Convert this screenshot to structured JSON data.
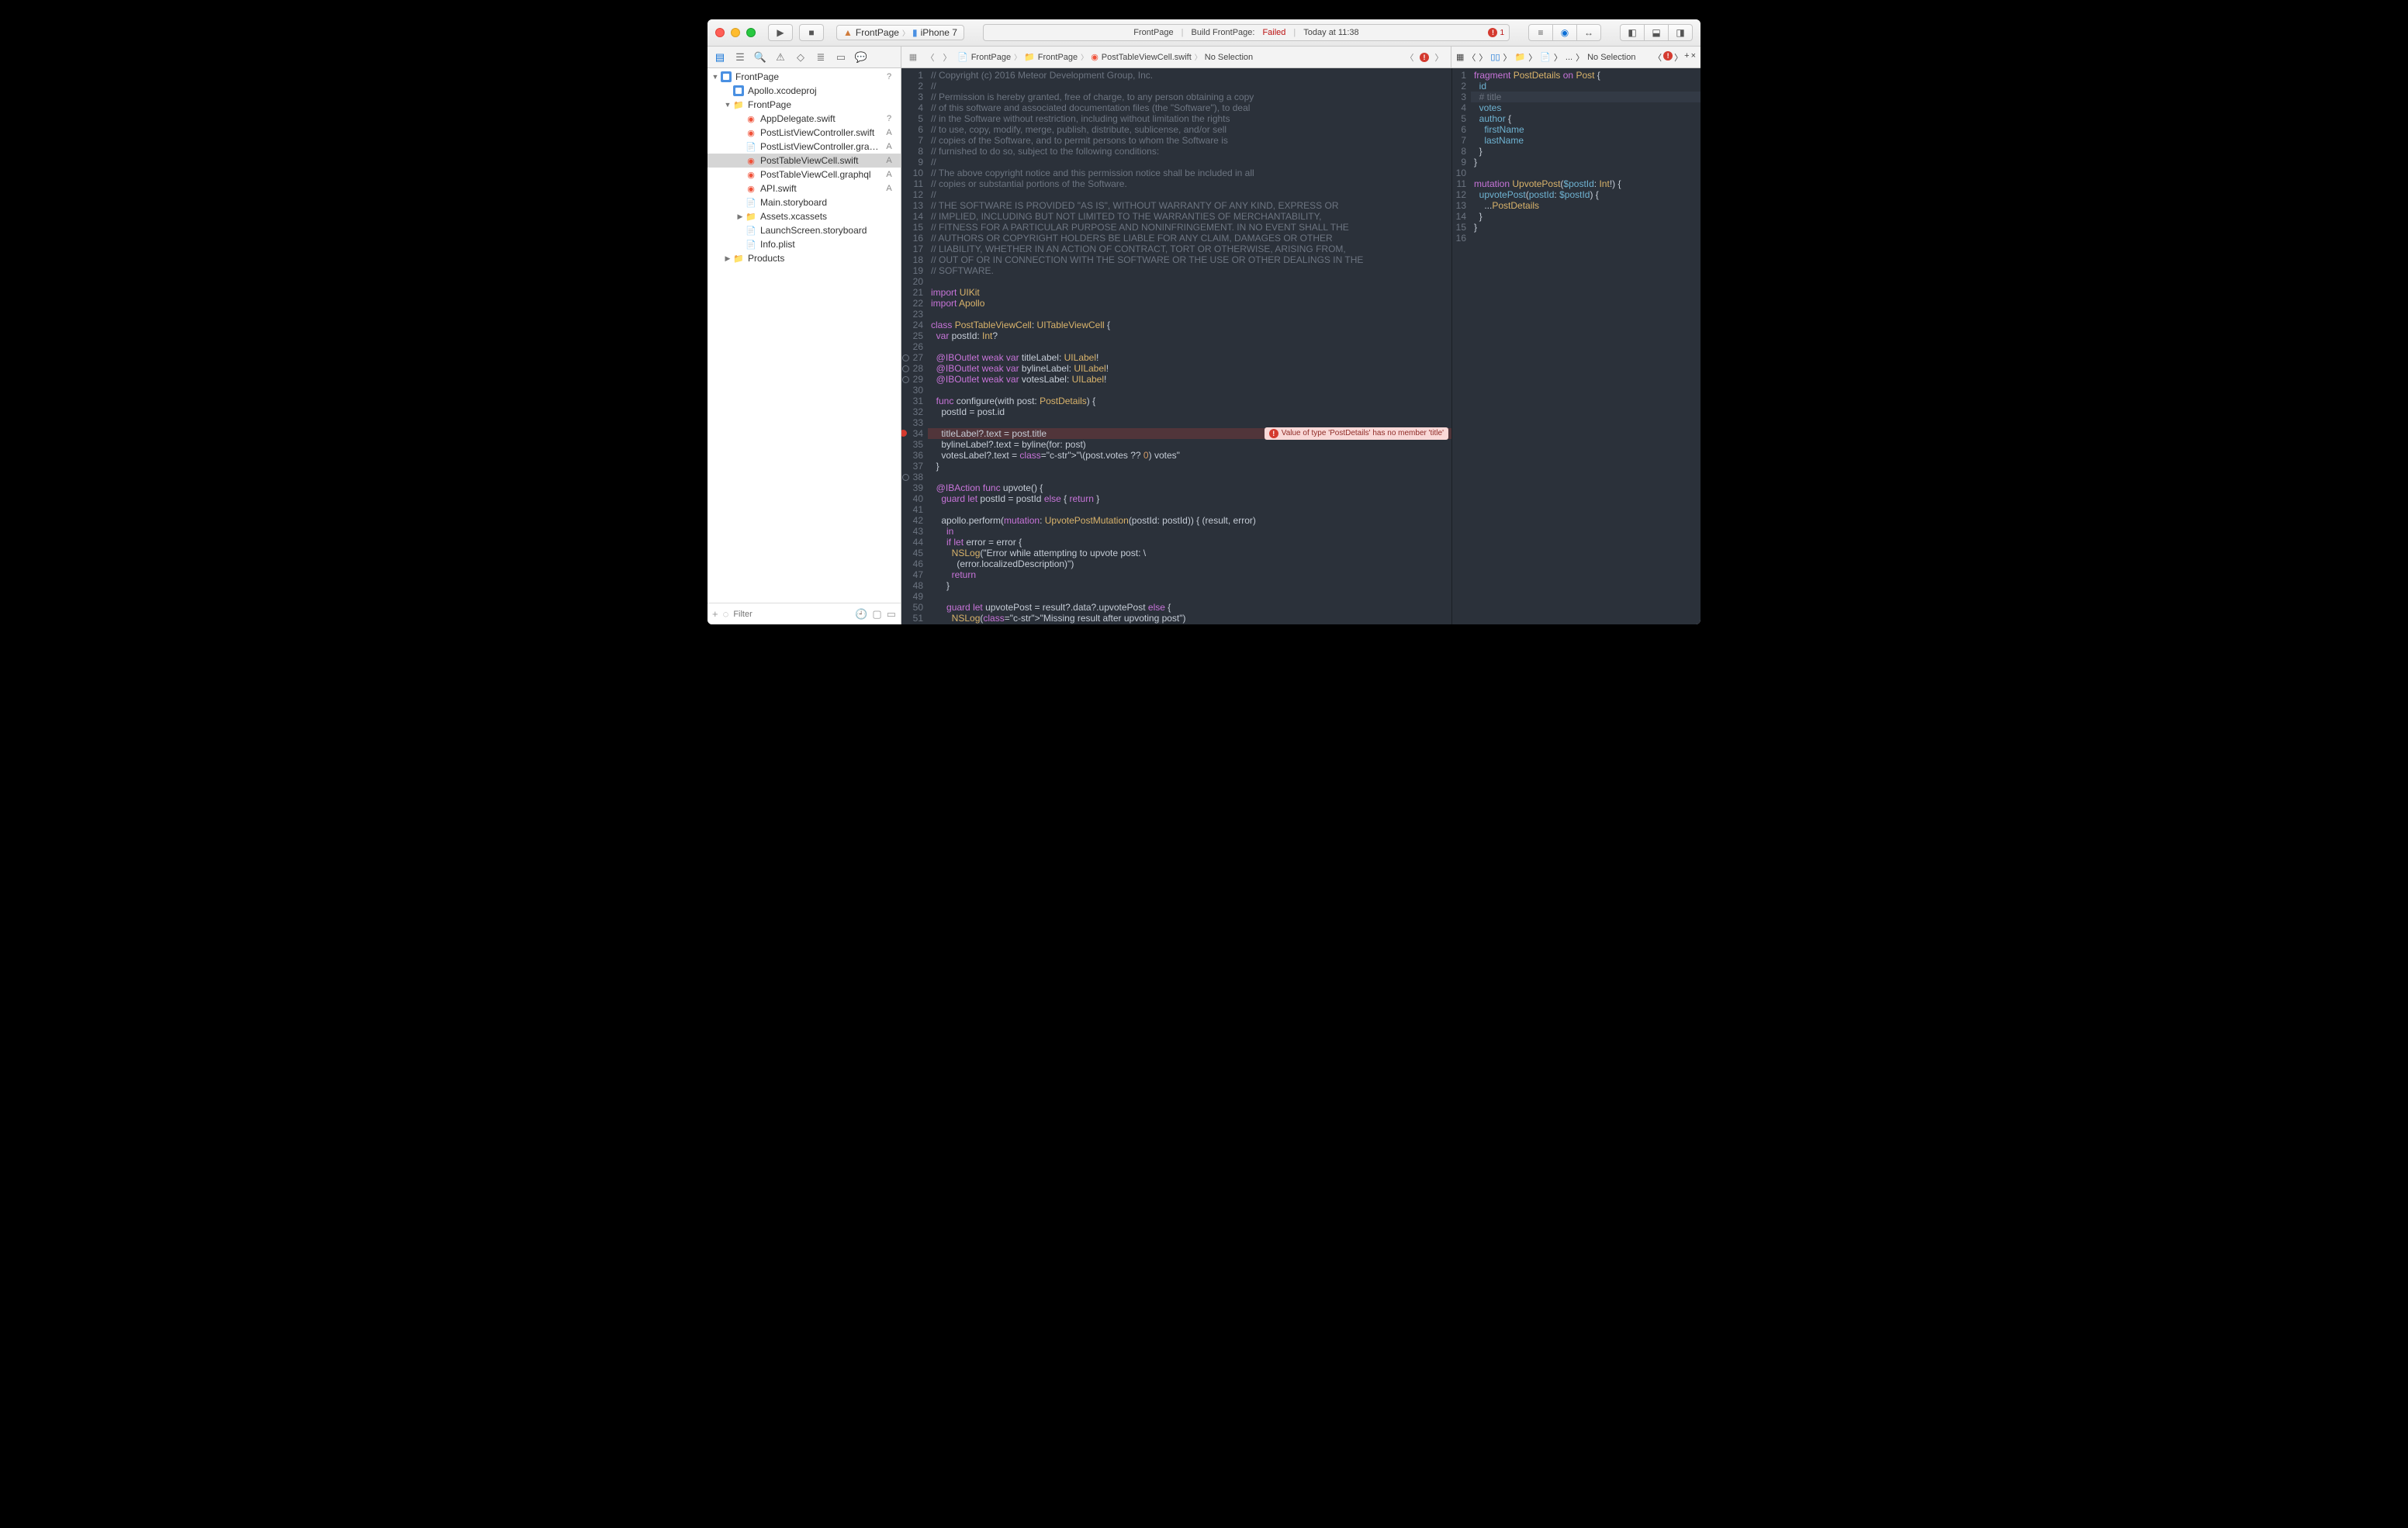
{
  "toolbar": {
    "scheme_target": "FrontPage",
    "scheme_device": "iPhone 7",
    "activity_project": "FrontPage",
    "activity_action": "Build FrontPage:",
    "activity_status": "Failed",
    "activity_time": "Today at 11:38",
    "error_count": "1"
  },
  "jumpbar1": {
    "items": [
      "FrontPage",
      "FrontPage",
      "PostTableViewCell.swift",
      "No Selection"
    ]
  },
  "jumpbar2": {
    "items": [
      "...",
      "No Selection"
    ]
  },
  "navigator": {
    "root": "FrontPage",
    "items": [
      {
        "label": "Apollo.xcodeproj",
        "indent": 1,
        "icon": "proj",
        "status": ""
      },
      {
        "label": "FrontPage",
        "indent": 1,
        "icon": "folder-y",
        "status": "",
        "open": true
      },
      {
        "label": "AppDelegate.swift",
        "indent": 2,
        "icon": "swift",
        "status": "?"
      },
      {
        "label": "PostListViewController.swift",
        "indent": 2,
        "icon": "swift",
        "status": "A"
      },
      {
        "label": "PostListViewController.graphql",
        "indent": 2,
        "icon": "file",
        "status": "A"
      },
      {
        "label": "PostTableViewCell.swift",
        "indent": 2,
        "icon": "swift",
        "status": "A",
        "selected": true
      },
      {
        "label": "PostTableViewCell.graphql",
        "indent": 2,
        "icon": "swift",
        "status": "A"
      },
      {
        "label": "API.swift",
        "indent": 2,
        "icon": "swift",
        "status": "A"
      },
      {
        "label": "Main.storyboard",
        "indent": 2,
        "icon": "sb",
        "status": ""
      },
      {
        "label": "Assets.xcassets",
        "indent": 2,
        "icon": "folder",
        "status": ""
      },
      {
        "label": "LaunchScreen.storyboard",
        "indent": 2,
        "icon": "sb",
        "status": ""
      },
      {
        "label": "Info.plist",
        "indent": 2,
        "icon": "plist",
        "status": ""
      },
      {
        "label": "Products",
        "indent": 1,
        "icon": "folder-y",
        "status": ""
      }
    ],
    "filter_placeholder": "Filter"
  },
  "editor1": {
    "error_line": 34,
    "error_msg": "Value of type 'PostDetails' has no member 'title'",
    "lines": [
      "// Copyright (c) 2016 Meteor Development Group, Inc.",
      "//",
      "// Permission is hereby granted, free of charge, to any person obtaining a copy",
      "// of this software and associated documentation files (the \"Software\"), to deal",
      "// in the Software without restriction, including without limitation the rights",
      "// to use, copy, modify, merge, publish, distribute, sublicense, and/or sell",
      "// copies of the Software, and to permit persons to whom the Software is",
      "// furnished to do so, subject to the following conditions:",
      "//",
      "// The above copyright notice and this permission notice shall be included in all",
      "// copies or substantial portions of the Software.",
      "//",
      "// THE SOFTWARE IS PROVIDED \"AS IS\", WITHOUT WARRANTY OF ANY KIND, EXPRESS OR",
      "// IMPLIED, INCLUDING BUT NOT LIMITED TO THE WARRANTIES OF MERCHANTABILITY,",
      "// FITNESS FOR A PARTICULAR PURPOSE AND NONINFRINGEMENT. IN NO EVENT SHALL THE",
      "// AUTHORS OR COPYRIGHT HOLDERS BE LIABLE FOR ANY CLAIM, DAMAGES OR OTHER",
      "// LIABILITY, WHETHER IN AN ACTION OF CONTRACT, TORT OR OTHERWISE, ARISING FROM,",
      "// OUT OF OR IN CONNECTION WITH THE SOFTWARE OR THE USE OR OTHER DEALINGS IN THE",
      "// SOFTWARE.",
      "",
      "import UIKit",
      "import Apollo",
      "",
      "class PostTableViewCell: UITableViewCell {",
      "  var postId: Int?",
      "",
      "  @IBOutlet weak var titleLabel: UILabel!",
      "  @IBOutlet weak var bylineLabel: UILabel!",
      "  @IBOutlet weak var votesLabel: UILabel!",
      "",
      "  func configure(with post: PostDetails) {",
      "    postId = post.id",
      "",
      "    titleLabel?.text = post.title",
      "    bylineLabel?.text = byline(for: post)",
      "    votesLabel?.text = \"\\(post.votes ?? 0) votes\"",
      "  }",
      "",
      "  @IBAction func upvote() {",
      "    guard let postId = postId else { return }",
      "",
      "    apollo.perform(mutation: UpvotePostMutation(postId: postId)) { (result, error)",
      "      in",
      "      if let error = error {",
      "        NSLog(\"Error while attempting to upvote post: \\",
      "          (error.localizedDescription)\")",
      "        return",
      "      }",
      "",
      "      guard let upvotePost = result?.data?.upvotePost else {",
      "        NSLog(\"Missing result after upvoting post\")"
    ]
  },
  "editor2": {
    "current_line": 3,
    "lines": [
      "fragment PostDetails on Post {",
      "  id",
      "  # title",
      "  votes",
      "  author {",
      "    firstName",
      "    lastName",
      "  }",
      "}",
      "",
      "mutation UpvotePost($postId: Int!) {",
      "  upvotePost(postId: $postId) {",
      "    ...PostDetails",
      "  }",
      "}",
      ""
    ]
  }
}
